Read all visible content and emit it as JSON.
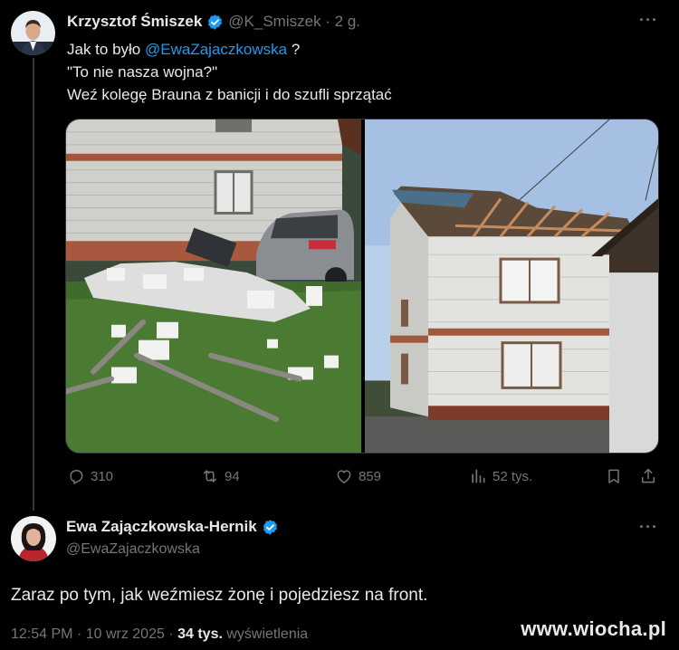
{
  "tweet1": {
    "author_name": "Krzysztof Śmiszek",
    "handle_time": "@K_Smiszek · 2 g.",
    "more": "···",
    "line1_prefix": "Jak to było ",
    "line1_mention": "@EwaZajaczkowska",
    "line1_suffix": " ?",
    "line2": "\"To nie nasza wojna?\"",
    "line3": "Weź kolegę Brauna z banicji i do szufli sprzątać",
    "stats": {
      "replies": "310",
      "reposts": "94",
      "likes": "859",
      "views": "52 tys."
    }
  },
  "tweet2": {
    "author_name": "Ewa Zajączkowska-Hernik",
    "handle": "@EwaZajaczkowska",
    "more": "···",
    "text": "Zaraz po tym, jak weźmiesz żonę i pojedziesz na front.",
    "time_date": "12:54 PM · 10 wrz 2025 · ",
    "views_count": "34 tys.",
    "views_label": " wyświetlenia"
  },
  "watermark": "www.wiocha.pl",
  "colors": {
    "background": "#000000",
    "text": "#e7e9ea",
    "muted": "#71767b",
    "link": "#1d9bf0",
    "verified": "#1d9bf0"
  },
  "icons": [
    "reply-icon",
    "repost-icon",
    "like-icon",
    "views-icon",
    "bookmark-icon",
    "share-icon",
    "verified-badge-icon",
    "more-icon"
  ]
}
